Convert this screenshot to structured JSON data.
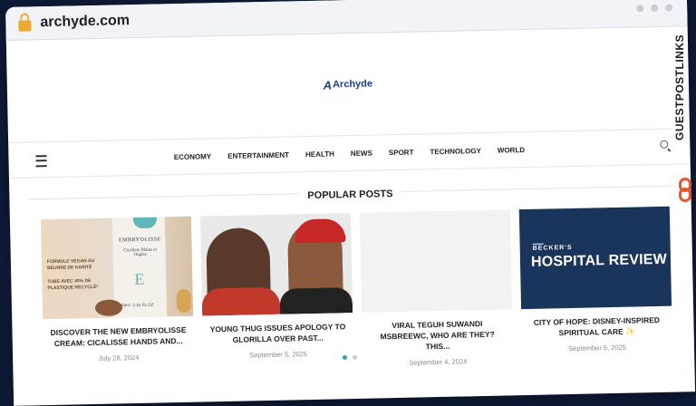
{
  "browser": {
    "url": "archyde.com"
  },
  "site": {
    "logo_text": "Archyde",
    "logo_mark": "A"
  },
  "nav": {
    "items": [
      "ECONOMY",
      "ENTERTAINMENT",
      "HEALTH",
      "NEWS",
      "SPORT",
      "TECHNOLOGY",
      "WORLD"
    ]
  },
  "section": {
    "title": "POPULAR POSTS"
  },
  "posts": [
    {
      "title": "DISCOVER THE NEW EMBRYOLISSE CREAM: CICALISSE HANDS AND...",
      "date": "July 28, 2024",
      "image": {
        "brand": "EMBRYOLISSE",
        "product": "Cicalisse Mains et Ongles",
        "mark": "E",
        "volume": "30ml - 1.01 FL.OZ",
        "label1": "FORMULE VEGAN AU BEURRE DE KARITÉ",
        "label2": "TUBE AVEC 40% DE PLASTIQUE RECYCLÉ*"
      }
    },
    {
      "title": "YOUNG THUG ISSUES APOLOGY TO GLORILLA OVER PAST...",
      "date": "September 5, 2025"
    },
    {
      "title": "VIRAL TEGUH SUWANDI MSBREEWC, WHO ARE THEY? THIS...",
      "date": "September 4, 2024"
    },
    {
      "title": "CITY OF HOPE: DISNEY-INSPIRED SPIRITUAL CARE ✨",
      "date": "September 5, 2025",
      "image": {
        "small": "BECKER'S",
        "big": "HOSPITAL REVIEW"
      }
    }
  ],
  "overlay": {
    "brand": "GUESTPOSTLINKS"
  },
  "colors": {
    "accent": "#3a9ea5",
    "lock": "#f0a830",
    "brand_orange": "#e4572e",
    "hospital_review_bg": "#19355c"
  }
}
